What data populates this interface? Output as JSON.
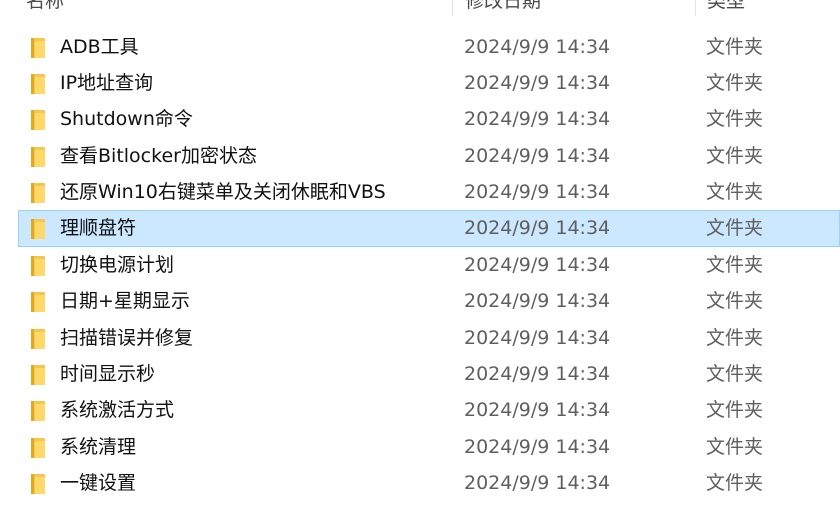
{
  "header": {
    "name_label": "名称",
    "date_label": "修改日期",
    "type_label": "类型"
  },
  "rows": [
    {
      "name": "ADB工具",
      "date": "2024/9/9 14:34",
      "type": "文件夹",
      "selected": false
    },
    {
      "name": "IP地址查询",
      "date": "2024/9/9 14:34",
      "type": "文件夹",
      "selected": false
    },
    {
      "name": "Shutdown命令",
      "date": "2024/9/9 14:34",
      "type": "文件夹",
      "selected": false
    },
    {
      "name": "查看Bitlocker加密状态",
      "date": "2024/9/9 14:34",
      "type": "文件夹",
      "selected": false
    },
    {
      "name": "还原Win10右键菜单及关闭休眠和VBS",
      "date": "2024/9/9 14:34",
      "type": "文件夹",
      "selected": false
    },
    {
      "name": "理顺盘符",
      "date": "2024/9/9 14:34",
      "type": "文件夹",
      "selected": true
    },
    {
      "name": "切换电源计划",
      "date": "2024/9/9 14:34",
      "type": "文件夹",
      "selected": false
    },
    {
      "name": "日期+星期显示",
      "date": "2024/9/9 14:34",
      "type": "文件夹",
      "selected": false
    },
    {
      "name": "扫描错误并修复",
      "date": "2024/9/9 14:34",
      "type": "文件夹",
      "selected": false
    },
    {
      "name": "时间显示秒",
      "date": "2024/9/9 14:34",
      "type": "文件夹",
      "selected": false
    },
    {
      "name": "系统激活方式",
      "date": "2024/9/9 14:34",
      "type": "文件夹",
      "selected": false
    },
    {
      "name": "系统清理",
      "date": "2024/9/9 14:34",
      "type": "文件夹",
      "selected": false
    },
    {
      "name": "一键设置",
      "date": "2024/9/9 14:34",
      "type": "文件夹",
      "selected": false
    }
  ],
  "icon": "folder-icon",
  "colors": {
    "selection_bg": "#cce8ff",
    "selection_border": "#99d1ff",
    "folder": "#f3c64d"
  }
}
